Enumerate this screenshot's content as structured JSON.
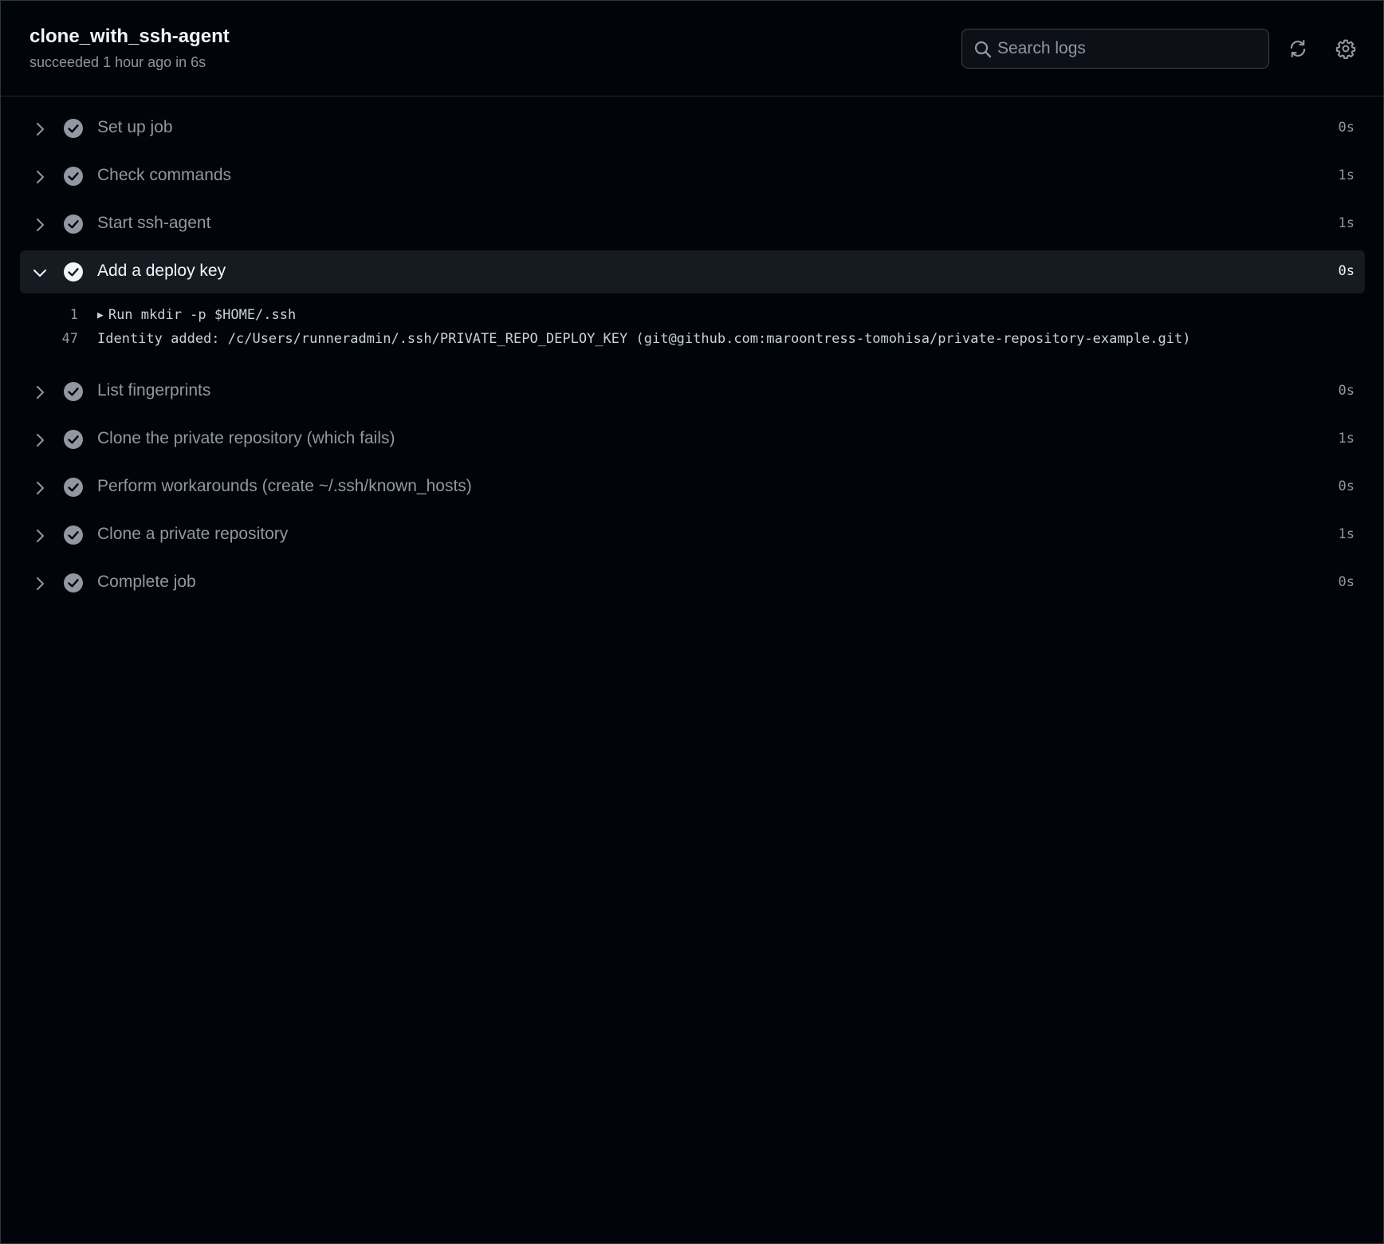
{
  "header": {
    "title": "clone_with_ssh-agent",
    "subtitle": "succeeded 1 hour ago in 6s"
  },
  "search": {
    "placeholder": "Search logs",
    "value": ""
  },
  "toolbar": {
    "refresh_icon": "sync-icon",
    "settings_icon": "gear-icon"
  },
  "colors": {
    "background": "#010409",
    "expanded_row": "#161b22",
    "text_muted": "#9198a1",
    "text_bright": "#f0f6fc",
    "check": "#9198a1"
  },
  "steps": [
    {
      "label": "Set up job",
      "duration": "0s",
      "status": "success",
      "expanded": false
    },
    {
      "label": "Check commands",
      "duration": "1s",
      "status": "success",
      "expanded": false
    },
    {
      "label": "Start ssh-agent",
      "duration": "1s",
      "status": "success",
      "expanded": false
    },
    {
      "label": "Add a deploy key",
      "duration": "0s",
      "status": "success",
      "expanded": true
    },
    {
      "label": "List fingerprints",
      "duration": "0s",
      "status": "success",
      "expanded": false
    },
    {
      "label": "Clone the private repository (which fails)",
      "duration": "1s",
      "status": "success",
      "expanded": false
    },
    {
      "label": "Perform workarounds (create ~/.ssh/known_hosts)",
      "duration": "0s",
      "status": "success",
      "expanded": false
    },
    {
      "label": "Clone a private repository",
      "duration": "1s",
      "status": "success",
      "expanded": false
    },
    {
      "label": "Complete job",
      "duration": "0s",
      "status": "success",
      "expanded": false
    }
  ],
  "log": {
    "lines": [
      {
        "number": "1",
        "caret": "▶",
        "text": "Run mkdir -p $HOME/.ssh"
      },
      {
        "number": "47",
        "caret": "",
        "text": "Identity added: /c/Users/runneradmin/.ssh/PRIVATE_REPO_DEPLOY_KEY (git@github.com:maroontress-tomohisa/private-repository-example.git)"
      }
    ]
  }
}
